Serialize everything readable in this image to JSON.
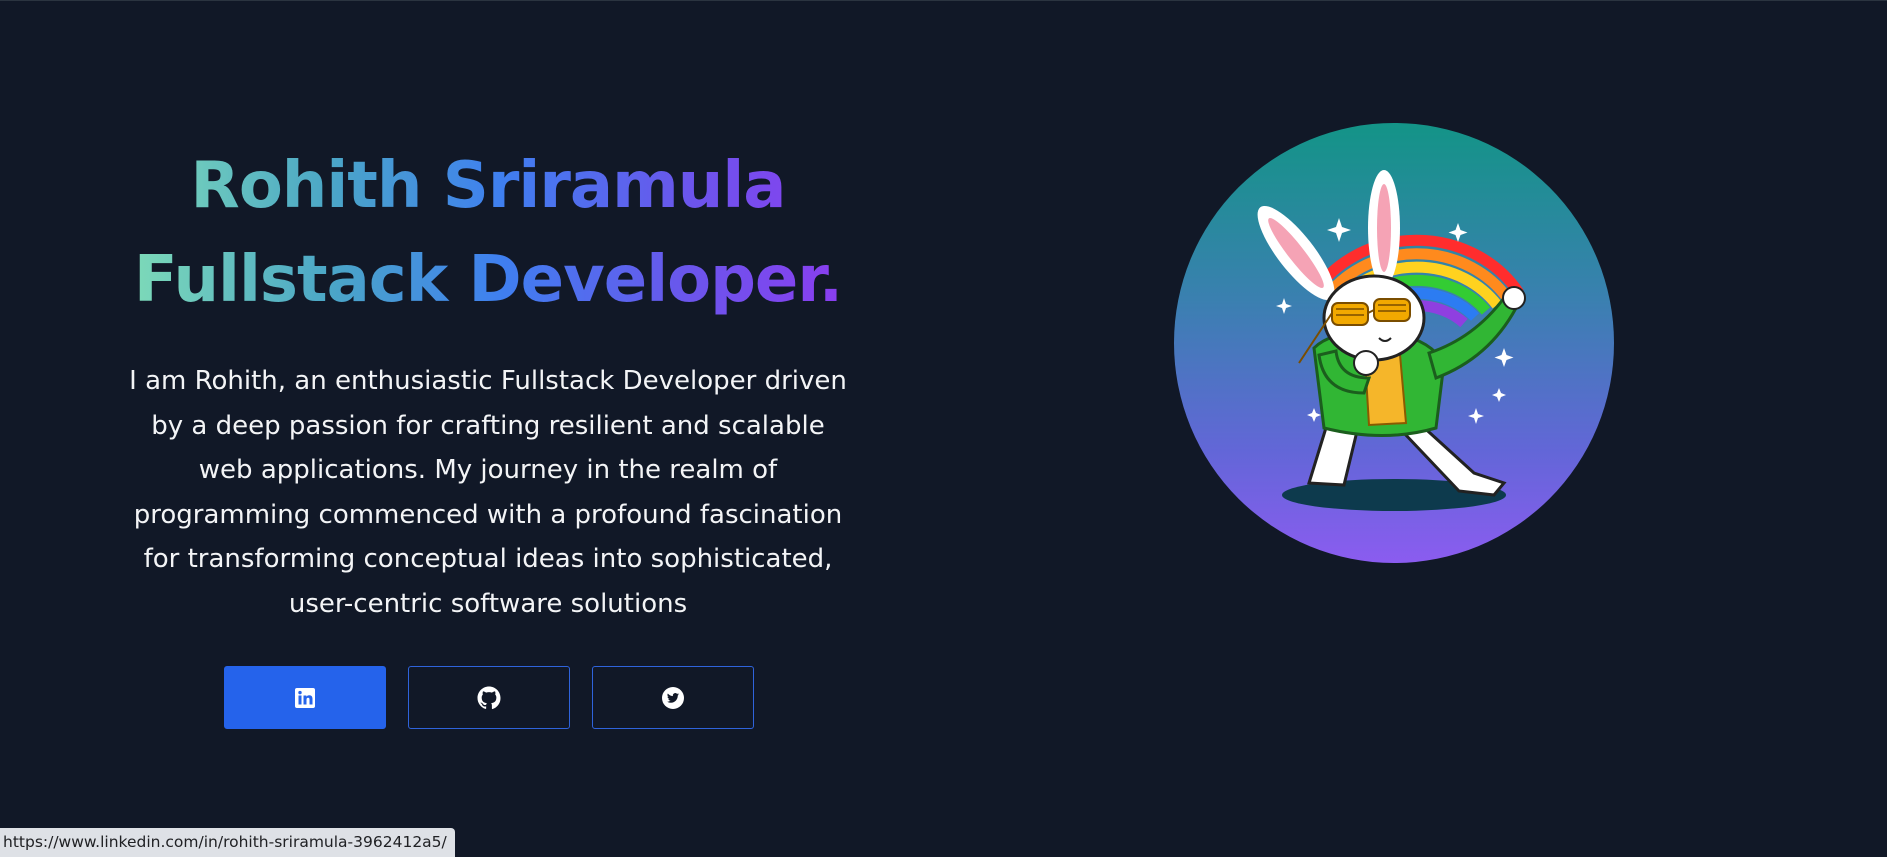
{
  "hero": {
    "title_line1": "Rohith Sriramula",
    "title_line2": "Fullstack Developer.",
    "bio": "I am Rohith, an enthusiastic Fullstack Developer driven by a deep passion for crafting resilient and scalable web applications. My journey in the realm of programming commenced with a profound fascination for transforming conceptual ideas into sophisticated, user-centric software solutions"
  },
  "socials": [
    {
      "icon": "linkedin-icon",
      "style": "filled"
    },
    {
      "icon": "github-icon",
      "style": "outline"
    },
    {
      "icon": "twitter-icon",
      "style": "outline"
    }
  ],
  "avatar": {
    "subject": "dabbing-rabbit-illustration"
  },
  "status_bar": {
    "url": "https://www.linkedin.com/in/rohith-sriramula-3962412a5/"
  },
  "colors": {
    "background": "#111827",
    "primary_button": "#2563eb",
    "outline_border": "#2f63db",
    "text": "#f3f4f6"
  }
}
